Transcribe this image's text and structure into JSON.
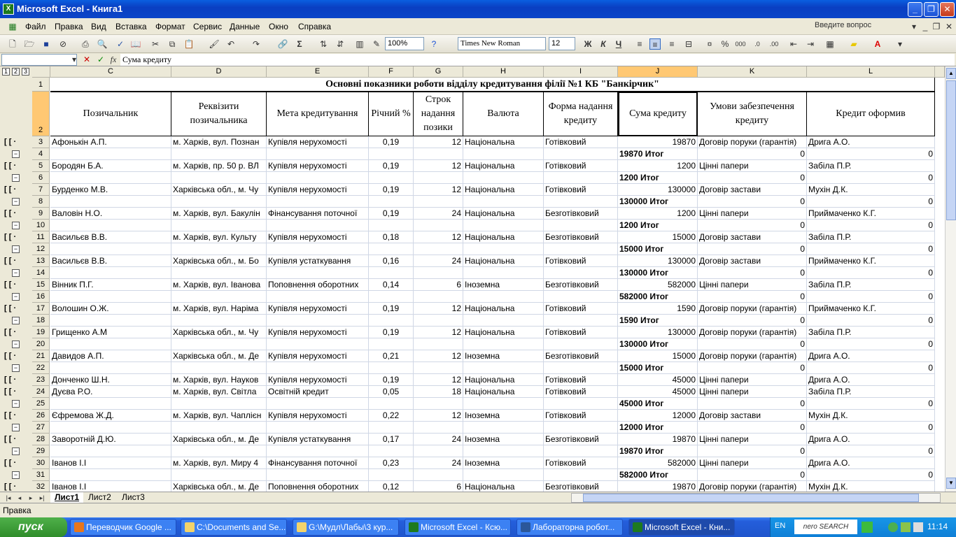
{
  "window": {
    "title": "Microsoft Excel - Книга1",
    "minimize": "_",
    "restore": "❐",
    "close": "✕"
  },
  "menu": {
    "items": [
      "Файл",
      "Правка",
      "Вид",
      "Вставка",
      "Формат",
      "Сервис",
      "Данные",
      "Окно",
      "Справка"
    ],
    "help_placeholder": "Введите вопрос"
  },
  "toolbar": {
    "zoom": "100%",
    "font": "Times New Roman",
    "size": "12",
    "bold": "Ж",
    "italic": "К",
    "underline": "Ч"
  },
  "formula": {
    "content": "Сума кредиту",
    "fx": "fx"
  },
  "outline_levels": [
    "1",
    "2",
    "3"
  ],
  "columns": [
    "C",
    "D",
    "E",
    "F",
    "G",
    "H",
    "I",
    "J",
    "K",
    "L"
  ],
  "title_row": "Основні показники роботи відділу кредитування філії №1 КБ \"Банкірчик\"",
  "headers": [
    "Позичальник",
    "Реквізити позичальника",
    "Мета кредитування",
    "Річний %",
    "Строк надання позики",
    "Валюта",
    "Форма надання кредиту",
    "Сума кредиту",
    "Умови забезпечення кредиту",
    "Кредит оформив"
  ],
  "rows": [
    {
      "n": "3",
      "type": "data",
      "c": [
        "Афонькін А.П.",
        "м. Харків, вул. Познан",
        "Купівля нерухомості",
        "0,19",
        "12",
        "Національна",
        "Готівковий",
        "19870",
        "Договір поруки (гарантія)",
        "Дрига А.О."
      ]
    },
    {
      "n": "4",
      "type": "total",
      "label": "19870 Итог",
      "k": "0",
      "l": "0"
    },
    {
      "n": "5",
      "type": "data",
      "c": [
        "Бородян Б.А.",
        "м. Харків, пр. 50 р. ВЛ",
        "Купівля нерухомості",
        "0,19",
        "12",
        "Національна",
        "Готівковий",
        "1200",
        "Цінні папери",
        "Забіла П.Р."
      ]
    },
    {
      "n": "6",
      "type": "total",
      "label": "1200 Итог",
      "k": "0",
      "l": "0"
    },
    {
      "n": "7",
      "type": "data",
      "c": [
        "Бурденко М.В.",
        "Харківська обл., м. Чу",
        "Купівля нерухомості",
        "0,19",
        "12",
        "Національна",
        "Готівковий",
        "130000",
        "Договір застави",
        "Мухін Д.К."
      ]
    },
    {
      "n": "8",
      "type": "total",
      "label": "130000 Итог",
      "k": "0",
      "l": "0"
    },
    {
      "n": "9",
      "type": "data",
      "c": [
        "Валовін Н.О.",
        "м. Харків, вул. Бакулін",
        "Фінансування поточної",
        "0,19",
        "24",
        "Національна",
        "Безготівковий",
        "1200",
        "Цінні папери",
        "Приймаченко К.Г."
      ]
    },
    {
      "n": "10",
      "type": "total",
      "label": "1200 Итог",
      "k": "0",
      "l": "0"
    },
    {
      "n": "11",
      "type": "data",
      "c": [
        "Васильєв В.В.",
        "м. Харків, вул. Культу",
        "Купівля нерухомості",
        "0,18",
        "12",
        "Національна",
        "Безготівковий",
        "15000",
        "Договір застави",
        "Забіла П.Р."
      ]
    },
    {
      "n": "12",
      "type": "total",
      "label": "15000 Итог",
      "k": "0",
      "l": "0"
    },
    {
      "n": "13",
      "type": "data",
      "c": [
        "Васильєв В.В.",
        "Харківська обл., м. Бо",
        "Купівля устаткування",
        "0,16",
        "24",
        "Національна",
        "Готівковий",
        "130000",
        "Договір застави",
        "Приймаченко К.Г."
      ]
    },
    {
      "n": "14",
      "type": "total",
      "label": "130000 Итог",
      "k": "0",
      "l": "0"
    },
    {
      "n": "15",
      "type": "data",
      "c": [
        "Вінник П.Г.",
        "м. Харків, вул. Іванова",
        "Поповнення оборотних",
        "0,14",
        "6",
        "Іноземна",
        "Безготівковий",
        "582000",
        "Цінні папери",
        "Забіла П.Р."
      ]
    },
    {
      "n": "16",
      "type": "total",
      "label": "582000 Итог",
      "k": "0",
      "l": "0"
    },
    {
      "n": "17",
      "type": "data",
      "c": [
        "Волошин О.Ж.",
        "м. Харків, вул. Наріма",
        "Купівля нерухомості",
        "0,19",
        "12",
        "Національна",
        "Готівковий",
        "1590",
        "Договір поруки (гарантія)",
        "Приймаченко К.Г."
      ]
    },
    {
      "n": "18",
      "type": "total",
      "label": "1590 Итог",
      "k": "0",
      "l": "0"
    },
    {
      "n": "19",
      "type": "data",
      "c": [
        "Грищенко А.М",
        "Харківська обл., м. Чу",
        "Купівля нерухомості",
        "0,19",
        "12",
        "Національна",
        "Готівковий",
        "130000",
        "Договір поруки (гарантія)",
        "Забіла П.Р."
      ]
    },
    {
      "n": "20",
      "type": "total",
      "label": "130000 Итог",
      "k": "0",
      "l": "0"
    },
    {
      "n": "21",
      "type": "data",
      "c": [
        "Давидов А.П.",
        "Харківська обл., м. Де",
        "Купівля нерухомості",
        "0,21",
        "12",
        "Іноземна",
        "Безготівковий",
        "15000",
        "Договір поруки (гарантія)",
        "Дрига А.О."
      ]
    },
    {
      "n": "22",
      "type": "total",
      "label": "15000 Итог",
      "k": "0",
      "l": "0"
    },
    {
      "n": "23",
      "type": "data",
      "c": [
        "Донченко Ш.Н.",
        "м. Харків, вул. Науков",
        "Купівля нерухомості",
        "0,19",
        "12",
        "Національна",
        "Готівковий",
        "45000",
        "Цінні папери",
        "Дрига А.О."
      ]
    },
    {
      "n": "24",
      "type": "data",
      "c": [
        "Дуєва Р.О.",
        "м. Харків, вул. Світла",
        "Освітній кредит",
        "0,05",
        "18",
        "Національна",
        "Готівковий",
        "45000",
        "Цінні папери",
        "Забіла П.Р."
      ]
    },
    {
      "n": "25",
      "type": "total",
      "label": "45000 Итог",
      "k": "0",
      "l": "0"
    },
    {
      "n": "26",
      "type": "data",
      "c": [
        "Єфремова Ж.Д.",
        "м. Харків, вул. Чаплієн",
        "Купівля нерухомості",
        "0,22",
        "12",
        "Іноземна",
        "Готівковий",
        "12000",
        "Договір застави",
        "Мухін Д.К."
      ]
    },
    {
      "n": "27",
      "type": "total",
      "label": "12000 Итог",
      "k": "0",
      "l": "0"
    },
    {
      "n": "28",
      "type": "data",
      "c": [
        "Заворотній Д.Ю.",
        "Харківська обл., м. Де",
        "Купівля устаткування",
        "0,17",
        "24",
        "Іноземна",
        "Безготівковий",
        "19870",
        "Цінні папери",
        "Дрига А.О."
      ]
    },
    {
      "n": "29",
      "type": "total",
      "label": "19870 Итог",
      "k": "0",
      "l": "0"
    },
    {
      "n": "30",
      "type": "data",
      "c": [
        "Іванов І.І",
        "м. Харків, вул. Миру 4",
        "Фінансування поточної",
        "0,23",
        "24",
        "Іноземна",
        "Готівковий",
        "582000",
        "Цінні папери",
        "Дрига А.О."
      ]
    },
    {
      "n": "31",
      "type": "total",
      "label": "582000 Итог",
      "k": "0",
      "l": "0"
    },
    {
      "n": "32",
      "type": "data",
      "c": [
        "Іванов І.І",
        "Харківська обл., м. Де",
        "Поповнення оборотних",
        "0,12",
        "6",
        "Національна",
        "Безготівковий",
        "19870",
        "Договір поруки (гарантія)",
        "Мухін Д.К."
      ]
    }
  ],
  "sheets": [
    "Лист1",
    "Лист2",
    "Лист3"
  ],
  "status": "Правка",
  "taskbar": {
    "start": "пуск",
    "tasks": [
      "Переводчик Google ...",
      "C:\\Documents and Se...",
      "G:\\Мудл\\Лабы\\3 кур...",
      "Microsoft Excel - Ксю...",
      "Лабораторна робот...",
      "Microsoft Excel - Кни..."
    ],
    "lang": "EN",
    "nero": "nero SEARCH",
    "clock": "11:14"
  }
}
